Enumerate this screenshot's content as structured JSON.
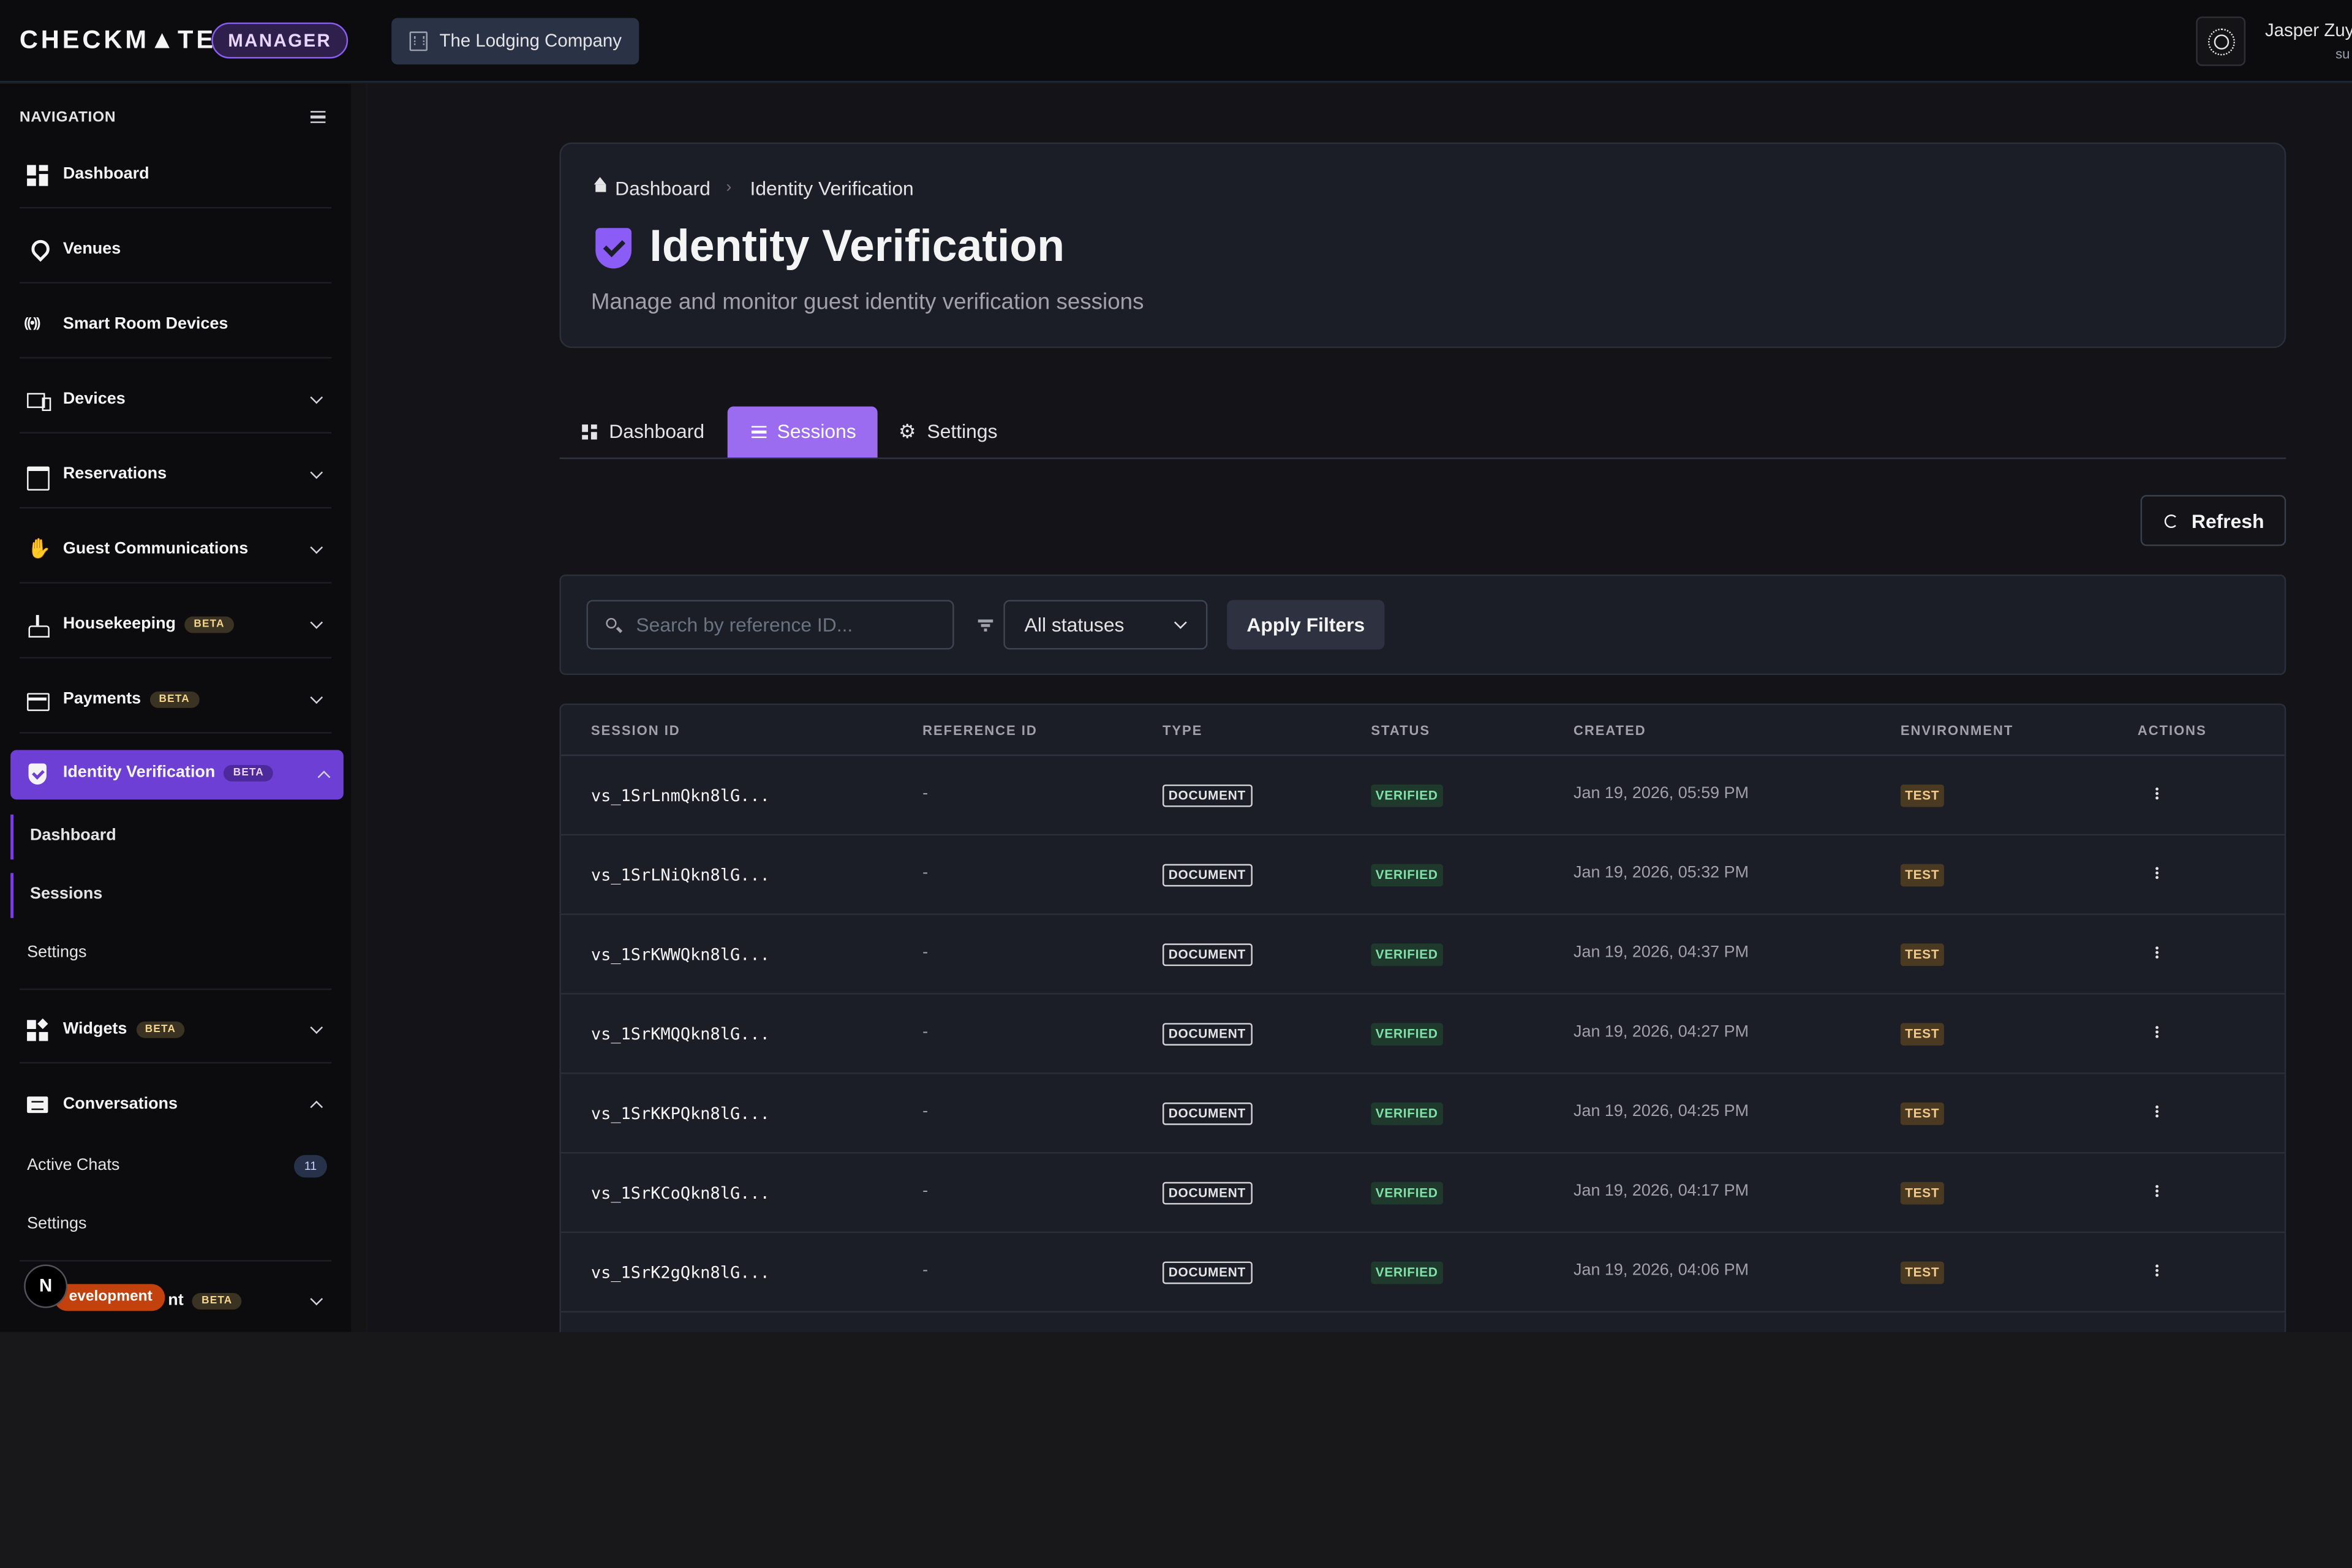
{
  "app": {
    "logo": "CHECKM▲TE",
    "badge": "MANAGER",
    "company": "The Lodging Company",
    "user_name": "Jasper Zuy",
    "user_sub": "su"
  },
  "sidebar": {
    "heading": "NAVIGATION",
    "items": [
      {
        "label": "Dashboard",
        "icon": "dashboard-icon"
      },
      {
        "label": "Venues",
        "icon": "location-pin-icon"
      },
      {
        "label": "Smart Room Devices",
        "icon": "wireless-signal-icon"
      },
      {
        "label": "Devices",
        "icon": "devices-icon"
      },
      {
        "label": "Reservations",
        "icon": "calendar-icon"
      },
      {
        "label": "Guest Communications",
        "icon": "waving-hand-icon"
      },
      {
        "label": "Housekeeping",
        "icon": "cleaning-icon",
        "badge": "BETA"
      },
      {
        "label": "Payments",
        "icon": "credit-card-icon",
        "badge": "BETA"
      },
      {
        "label": "Identity Verification",
        "icon": "shield-check-icon",
        "badge": "BETA"
      },
      {
        "label": "Widgets",
        "icon": "widgets-icon",
        "badge": "BETA"
      },
      {
        "label": "Conversations",
        "icon": "chat-icon"
      },
      {
        "label": "nt",
        "badge": "BETA"
      }
    ],
    "identity_sub": [
      "Dashboard",
      "Sessions",
      "Settings"
    ],
    "conversations_sub": [
      {
        "label": "Active Chats",
        "count": "11"
      },
      {
        "label": "Settings"
      }
    ],
    "dev_indicator": "N",
    "dev_label": "evelopment"
  },
  "header": {
    "breadcrumb_home": "Dashboard",
    "breadcrumb_sep": "›",
    "breadcrumb_current": "Identity Verification",
    "title": "Identity Verification",
    "subtitle": "Manage and monitor guest identity verification sessions"
  },
  "tabs": [
    {
      "label": "Dashboard",
      "active": false
    },
    {
      "label": "Sessions",
      "active": true
    },
    {
      "label": "Settings",
      "active": false
    }
  ],
  "toolbar": {
    "refresh": "Refresh"
  },
  "filters": {
    "search_placeholder": "Search by reference ID...",
    "search_value": "",
    "status_selected": "All statuses",
    "apply": "Apply Filters"
  },
  "table": {
    "headers": [
      "SESSION ID",
      "REFERENCE ID",
      "TYPE",
      "STATUS",
      "CREATED",
      "ENVIRONMENT",
      "ACTIONS"
    ],
    "rows": [
      {
        "session_id": "vs_1SrLnmQkn8lG...",
        "reference_id": "-",
        "type": "DOCUMENT",
        "status": "VERIFIED",
        "created": "Jan 19, 2026, 05:59 PM",
        "environment": "TEST"
      },
      {
        "session_id": "vs_1SrLNiQkn8lG...",
        "reference_id": "-",
        "type": "DOCUMENT",
        "status": "VERIFIED",
        "created": "Jan 19, 2026, 05:32 PM",
        "environment": "TEST"
      },
      {
        "session_id": "vs_1SrKWWQkn8lG...",
        "reference_id": "-",
        "type": "DOCUMENT",
        "status": "VERIFIED",
        "created": "Jan 19, 2026, 04:37 PM",
        "environment": "TEST"
      },
      {
        "session_id": "vs_1SrKMQQkn8lG...",
        "reference_id": "-",
        "type": "DOCUMENT",
        "status": "VERIFIED",
        "created": "Jan 19, 2026, 04:27 PM",
        "environment": "TEST"
      },
      {
        "session_id": "vs_1SrKKPQkn8lG...",
        "reference_id": "-",
        "type": "DOCUMENT",
        "status": "VERIFIED",
        "created": "Jan 19, 2026, 04:25 PM",
        "environment": "TEST"
      },
      {
        "session_id": "vs_1SrKCoQkn8lG...",
        "reference_id": "-",
        "type": "DOCUMENT",
        "status": "VERIFIED",
        "created": "Jan 19, 2026, 04:17 PM",
        "environment": "TEST"
      },
      {
        "session_id": "vs_1SrK2gQkn8lG...",
        "reference_id": "-",
        "type": "DOCUMENT",
        "status": "VERIFIED",
        "created": "Jan 19, 2026, 04:06 PM",
        "environment": "TEST"
      }
    ]
  },
  "colors": {
    "accent": "#8b5cf6",
    "sidebar_active": "#6d3fd4",
    "verified_text": "#7ee2a8",
    "test_text": "#f3c98a",
    "background": "#141418"
  }
}
